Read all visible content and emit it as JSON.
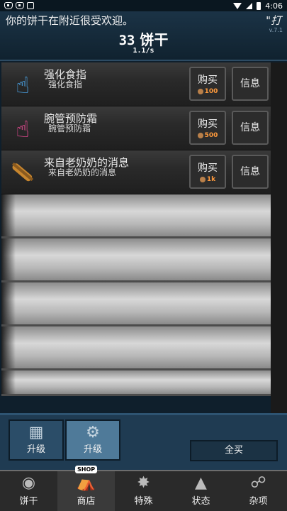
{
  "status_bar": {
    "time": "4:06"
  },
  "header": {
    "news": "你的饼干在附近很受欢迎。",
    "news_tail": "\"打",
    "version": "v.7.1",
    "cookie_count": "33",
    "cookie_unit": "饼干",
    "cps": "1.1/s"
  },
  "upgrades": [
    {
      "title": "强化食指",
      "subtitle": "强化食指",
      "icon": "pointer-icon",
      "buy_label": "购买",
      "price": "100",
      "info_label": "信息"
    },
    {
      "title": "腕管预防霜",
      "subtitle": "腕管预防霜",
      "icon": "pink-pointer-icon",
      "buy_label": "购买",
      "price": "500",
      "info_label": "信息"
    },
    {
      "title": "来自老奶奶的消息",
      "subtitle": "来自老奶奶的消息",
      "icon": "rolling-pin-icon",
      "buy_label": "购买",
      "price": "1k",
      "info_label": "信息"
    }
  ],
  "tabs": [
    {
      "label": "升级",
      "icon": "bricks-icon"
    },
    {
      "label": "升级",
      "icon": "gear-icon"
    }
  ],
  "buy_all_label": "全买",
  "bottom_nav": [
    {
      "label": "饼干",
      "icon": "cookie-icon"
    },
    {
      "label": "商店",
      "icon": "shop-icon",
      "badge": "SHOP"
    },
    {
      "label": "特殊",
      "icon": "special-icon"
    },
    {
      "label": "状态",
      "icon": "stats-icon"
    },
    {
      "label": "杂项",
      "icon": "misc-icon"
    }
  ]
}
